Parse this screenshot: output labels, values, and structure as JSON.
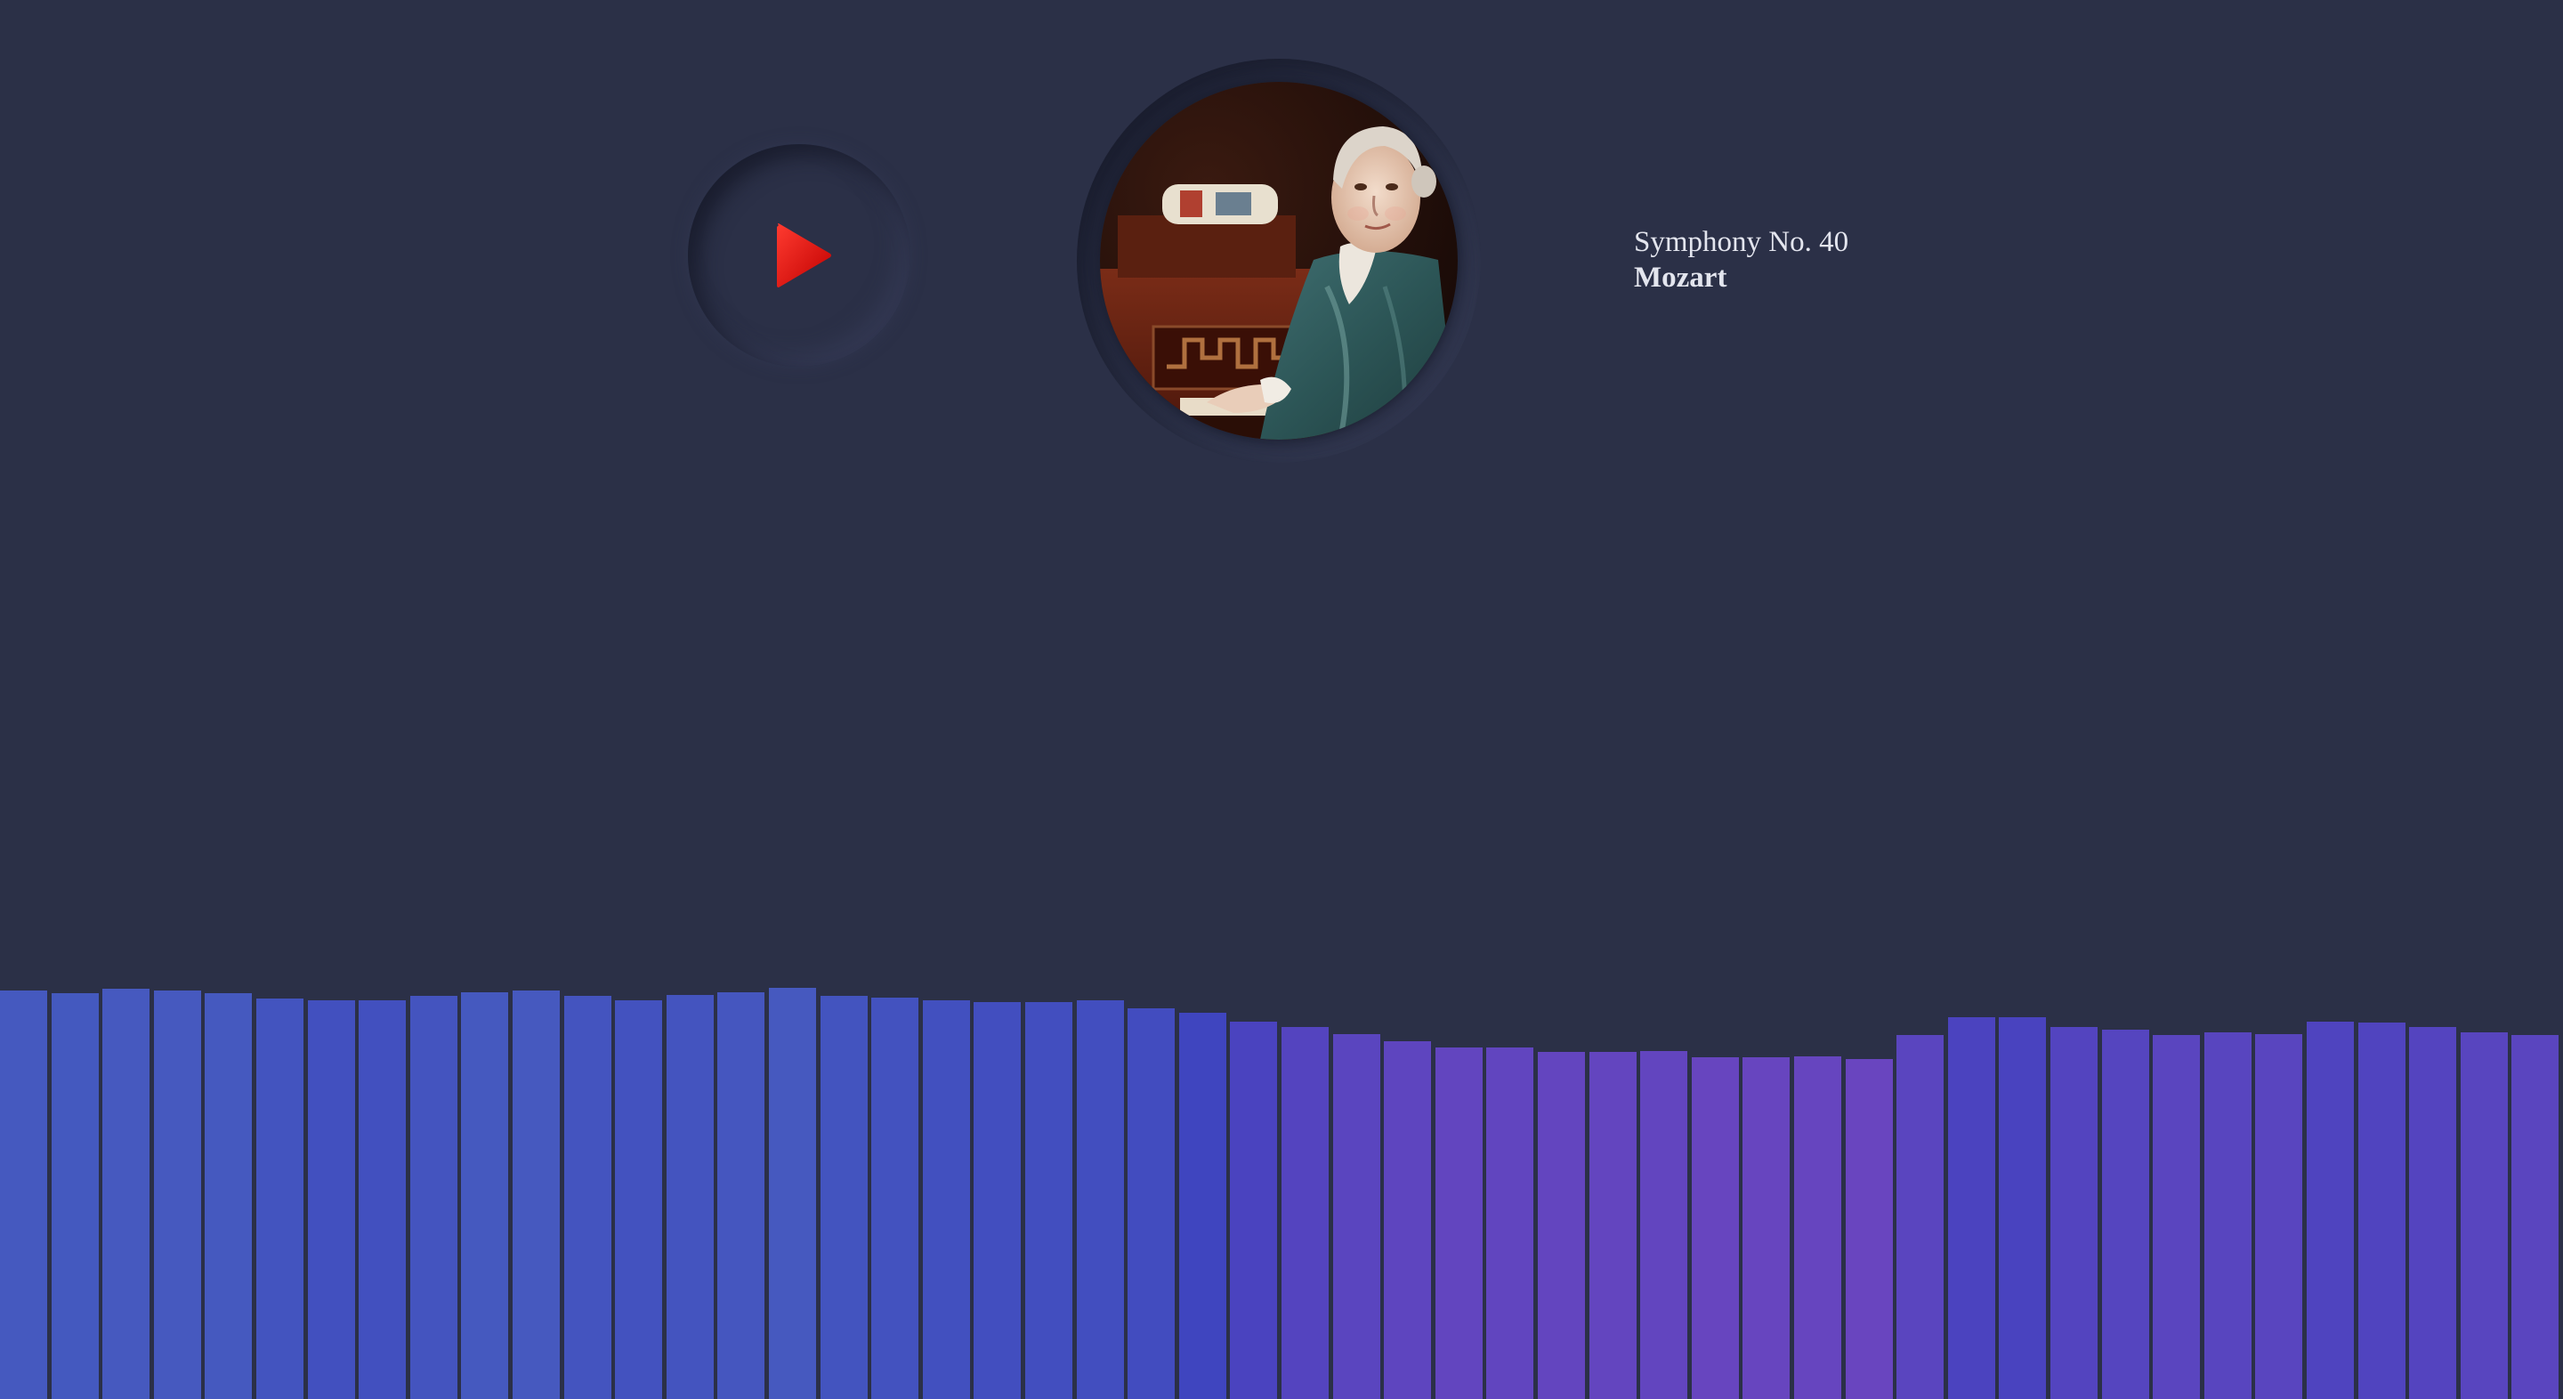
{
  "player": {
    "play_icon": "play-icon",
    "play_color": "#e01010",
    "album_art": "portrait-of-young-mozart-at-harpsichord"
  },
  "track": {
    "title": "Symphony No. 40",
    "artist": "Mozart"
  },
  "visualizer": {
    "levels": [
      0.292,
      0.29,
      0.293,
      0.292,
      0.29,
      0.286,
      0.285,
      0.285,
      0.288,
      0.291,
      0.292,
      0.288,
      0.285,
      0.289,
      0.291,
      0.294,
      0.288,
      0.287,
      0.285,
      0.284,
      0.284,
      0.285,
      0.279,
      0.276,
      0.27,
      0.266,
      0.261,
      0.256,
      0.251,
      0.251,
      0.248,
      0.248,
      0.249,
      0.244,
      0.244,
      0.245,
      0.243,
      0.26,
      0.273,
      0.273,
      0.266,
      0.264,
      0.26,
      0.262,
      0.261,
      0.27,
      0.269,
      0.266,
      0.262,
      0.26
    ],
    "colors": [
      "#4559bf",
      "#4459bf",
      "#4659bf",
      "#4659bf",
      "#4559bf",
      "#4354bf",
      "#4250bf",
      "#4250bf",
      "#4454bf",
      "#4559bf",
      "#4659bf",
      "#4454bf",
      "#4352bf",
      "#4454bf",
      "#4556bf",
      "#4659bf",
      "#4354bf",
      "#4352bf",
      "#4250bf",
      "#424ebf",
      "#424ebf",
      "#424ebf",
      "#424cbf",
      "#3f45bf",
      "#4a43bf",
      "#5444bf",
      "#5a45bf",
      "#5e45bf",
      "#6245bf",
      "#6145bf",
      "#6345bf",
      "#6345bf",
      "#6245bf",
      "#6745bf",
      "#6745bf",
      "#6645bf",
      "#6945bf",
      "#5a45bf",
      "#4b43bf",
      "#4943bf",
      "#5344bf",
      "#5545bf",
      "#5a45bf",
      "#5845bf",
      "#5945bf",
      "#4f44bf",
      "#5044bf",
      "#5444bf",
      "#5845bf",
      "#5a45bf"
    ]
  }
}
